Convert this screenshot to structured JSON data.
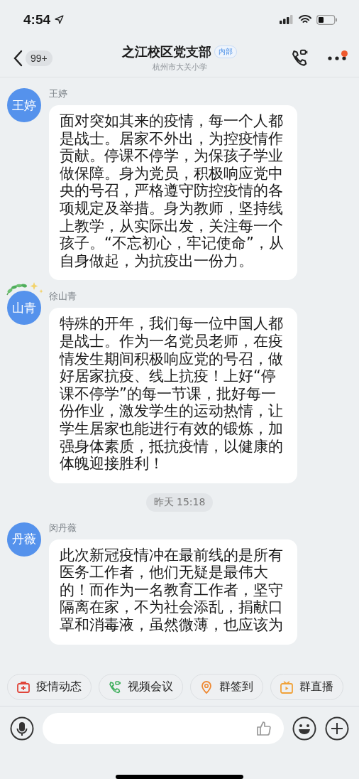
{
  "status_bar": {
    "time": "4:54"
  },
  "header": {
    "back_badge": "99+",
    "title": "之江校区党支部",
    "tag": "内部",
    "subtitle": "杭州市大关小学",
    "has_notification": true
  },
  "messages": [
    {
      "kind": "message",
      "avatar": "王婷",
      "sender": "王婷",
      "decorated": false,
      "text": "面对突如其来的疫情，每一个人都是战士。居家不外出，为控疫情作贡献。停课不停学，为保孩子学业做保障。身为党员，积极响应党中央的号召，严格遵守防控疫情的各项规定及举措。身为教师，坚持线上教学，从实际出发，关注每一个孩子。“不忘初心，牢记使命”，从自身做起，为抗疫出一份力。"
    },
    {
      "kind": "message",
      "avatar": "山青",
      "sender": "徐山青",
      "decorated": true,
      "text": "特殊的开年，我们每一位中国人都是战士。作为一名党员老师，在疫情发生期间积极响应党的号召，做好居家抗疫、线上抗疫！上好“停课不停学”的每一节课，批好每一份作业，激发学生的运动热情，让学生居家也能进行有效的锻炼，加强身体素质，抵抗疫情，以健康的体魄迎接胜利！"
    },
    {
      "kind": "time",
      "text": "昨天 15:18"
    },
    {
      "kind": "message",
      "avatar": "丹薇",
      "sender": "闵丹薇",
      "decorated": false,
      "text": "此次新冠疫情冲在最前线的是所有医务工作者，他们无疑是最伟大的！而作为一名教育工作者，坚守隔离在家，不为社会添乱，捐献口罩和消毒液，虽然微薄，也应该为"
    }
  ],
  "shortcuts": [
    {
      "kind": "medkit",
      "label": "疫情动态"
    },
    {
      "kind": "call",
      "label": "视频会议"
    },
    {
      "kind": "pin",
      "label": "群签到"
    },
    {
      "kind": "tv",
      "label": "群直播"
    }
  ]
}
